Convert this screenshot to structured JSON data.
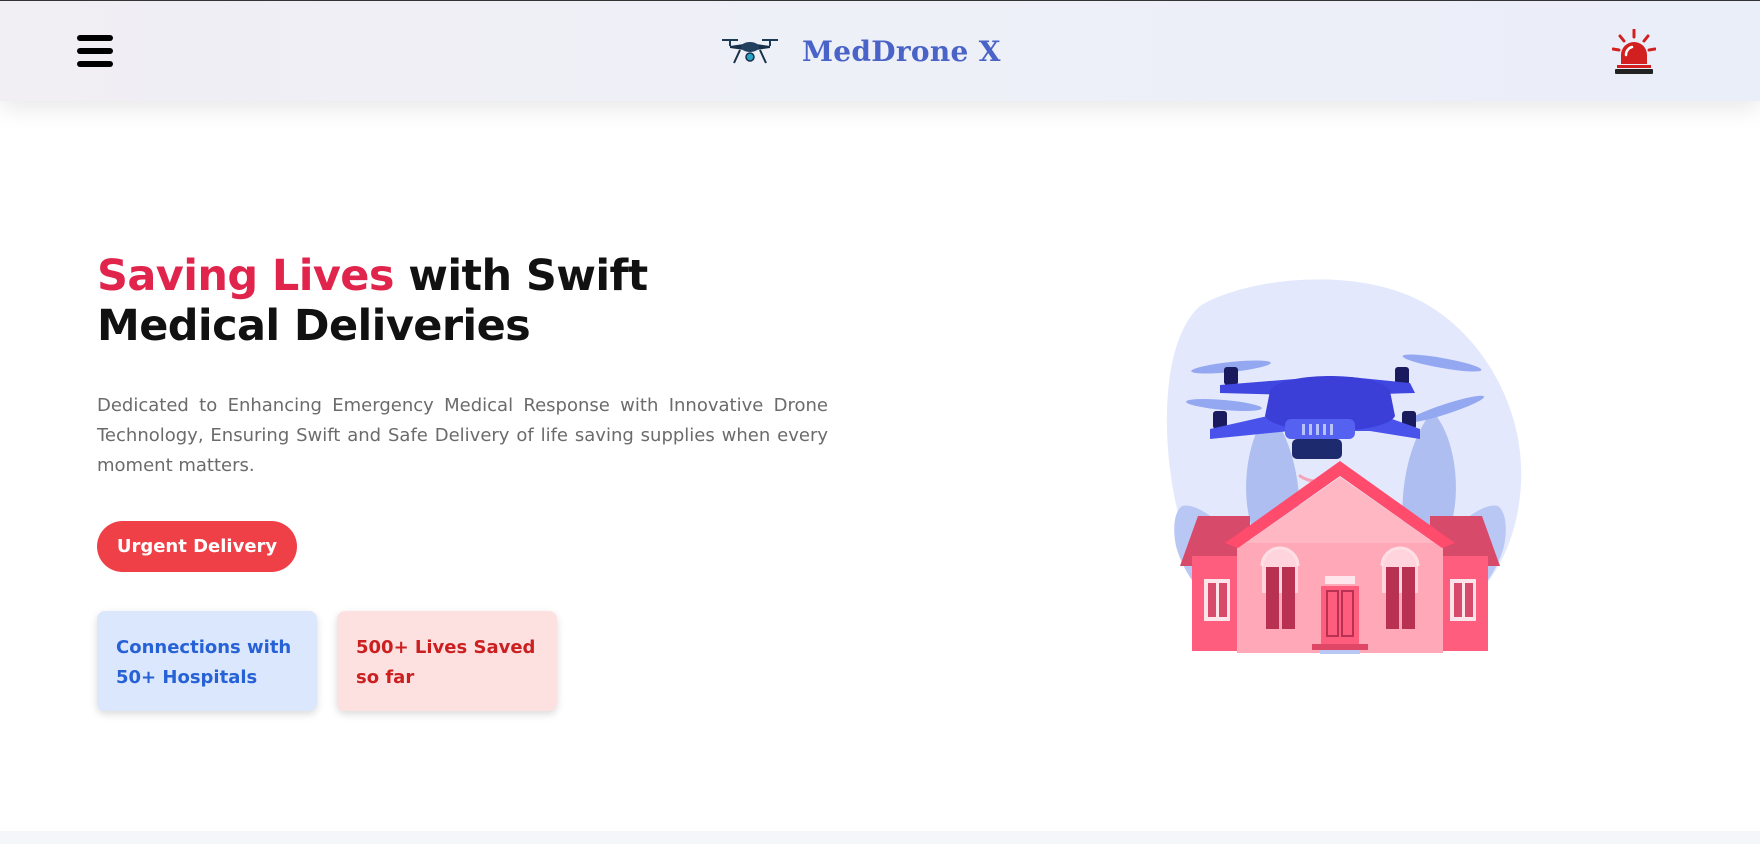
{
  "brand": {
    "name": "MedDrone X",
    "logo_icon": "drone-icon",
    "color": "#4a63c8"
  },
  "navbar": {
    "menu_icon": "hamburger-menu-icon",
    "emergency_icon": "siren-icon"
  },
  "hero": {
    "headline_accent": "Saving Lives",
    "headline_rest": " with Swift Medical Deliveries",
    "tagline": "Dedicated to Enhancing Emergency Medical Response with Innovative Drone Technology, Ensuring Swift and Safe Delivery of life saving supplies when every moment matters.",
    "cta_label": "Urgent Delivery",
    "illustration": "drone-over-house-illustration"
  },
  "stats": [
    {
      "text": "Connections with 50+ Hospitals",
      "color": "#2661d6",
      "background": "#dbe7fd"
    },
    {
      "text": "500+ Lives Saved so far",
      "color": "#cc2020",
      "background": "#fde1e1"
    }
  ],
  "colors": {
    "accent_red": "#e0244c",
    "cta_red": "#ef4048"
  }
}
